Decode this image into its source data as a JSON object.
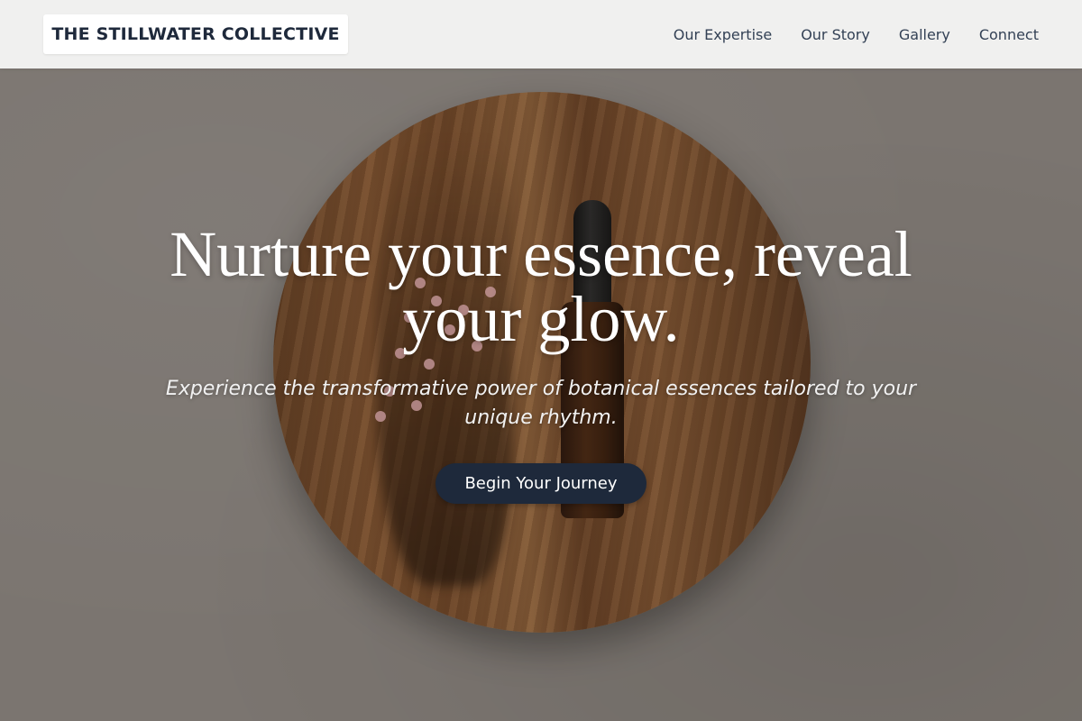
{
  "header": {
    "brand": "THE STILLWATER COLLECTIVE",
    "nav": [
      {
        "label": "Our Expertise"
      },
      {
        "label": "Our Story"
      },
      {
        "label": "Gallery"
      },
      {
        "label": "Connect"
      }
    ]
  },
  "hero": {
    "title": "Nurture your essence, reveal your glow.",
    "subtitle": "Experience the transformative power of botanical essences tailored to your unique rhythm.",
    "cta_label": "Begin Your Journey"
  },
  "colors": {
    "primary": "#1e293b",
    "header_bg": "#f5f5f5",
    "hero_text": "#ffffff"
  }
}
